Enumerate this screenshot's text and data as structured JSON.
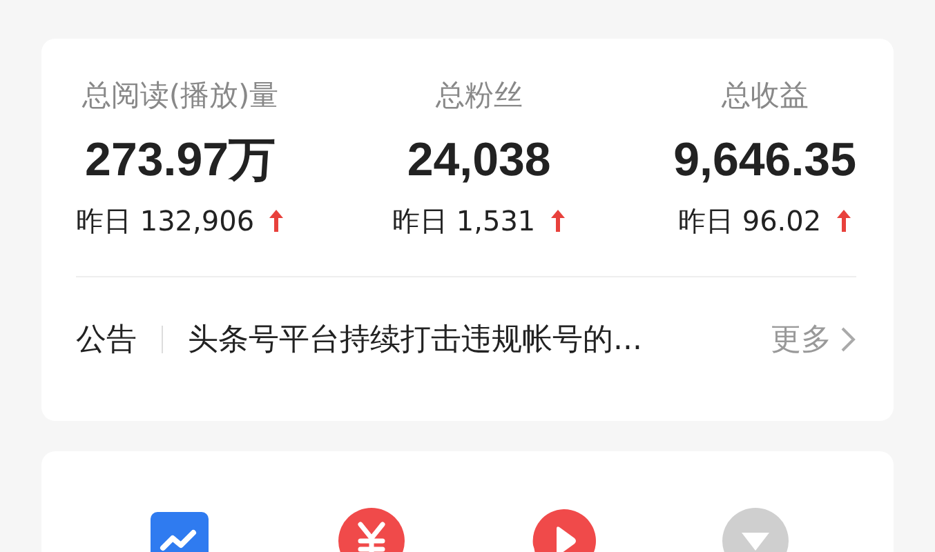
{
  "stats": [
    {
      "label": "总阅读(播放)量",
      "value": "273.97万",
      "yesterday": "昨日 132,906",
      "rising": true
    },
    {
      "label": "总粉丝",
      "value": "24,038",
      "yesterday": "昨日 1,531",
      "rising": true
    },
    {
      "label": "总收益",
      "value": "9,646.35",
      "yesterday": "昨日 96.02",
      "rising": true
    }
  ],
  "notice": {
    "label": "公告",
    "text": "头条号平台持续打击违规帐号的...",
    "more": "更多"
  },
  "shortcuts": [
    {
      "kind": "chart"
    },
    {
      "kind": "income"
    },
    {
      "kind": "video"
    },
    {
      "kind": "more"
    }
  ]
}
